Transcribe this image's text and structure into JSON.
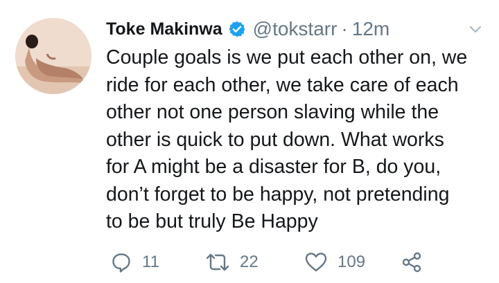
{
  "tweet": {
    "author": {
      "display_name": "Toke Makinwa",
      "handle": "@tokstarr",
      "verified": true,
      "verified_icon": "verified-badge-icon",
      "avatar": "profile-photo"
    },
    "separator": "·",
    "timestamp": "12m",
    "body_lines": [
      "Couple goals is we put each other on, we",
      "ride for each other, we take care of each",
      "other not one person slaving while the",
      "other is quick to put down. What works",
      "for A might be a disaster for B, do you,",
      "don’t forget to be happy, not pretending",
      "to be but truly Be Happy"
    ],
    "actions": {
      "reply_count": "11",
      "retweet_count": "22",
      "like_count": "109"
    }
  },
  "colors": {
    "text": "#14171a",
    "secondary": "#657786",
    "verified_blue": "#1da1f2",
    "background": "#ffffff"
  }
}
